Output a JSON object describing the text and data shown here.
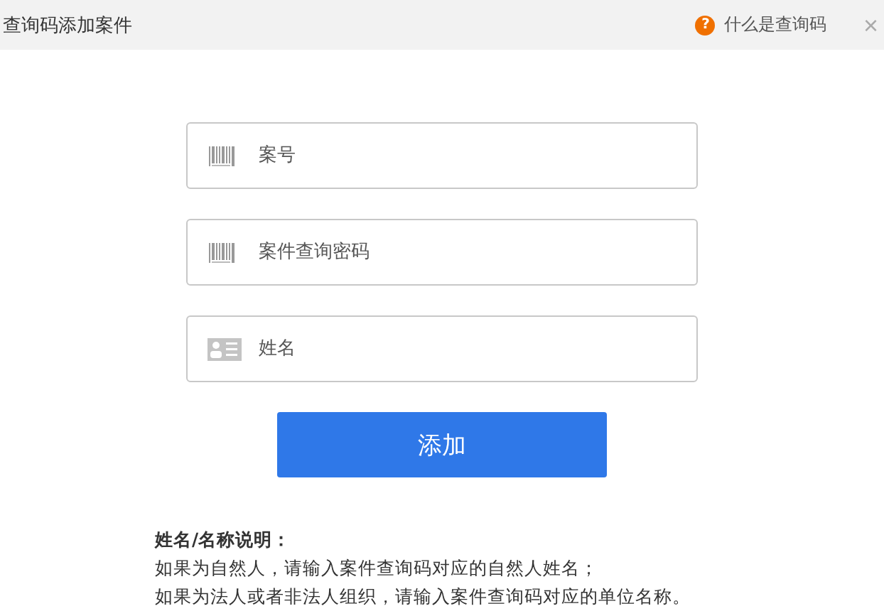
{
  "window": {
    "title": "查询码添加案件",
    "help_link": "什么是查询码",
    "help_icon": "?",
    "close": "×"
  },
  "fields": [
    {
      "kind": "barcode",
      "placeholder": "案号"
    },
    {
      "kind": "barcode",
      "placeholder": "案件查询密码"
    },
    {
      "kind": "person",
      "placeholder": "姓名"
    }
  ],
  "submit": "添加",
  "note": {
    "title": "姓名/名称说明：",
    "lines": [
      "如果为自然人，请输入案件查询码对应的自然人姓名；",
      "如果为法人或者非法人组织，请输入案件查询码对应的单位名称。"
    ]
  }
}
